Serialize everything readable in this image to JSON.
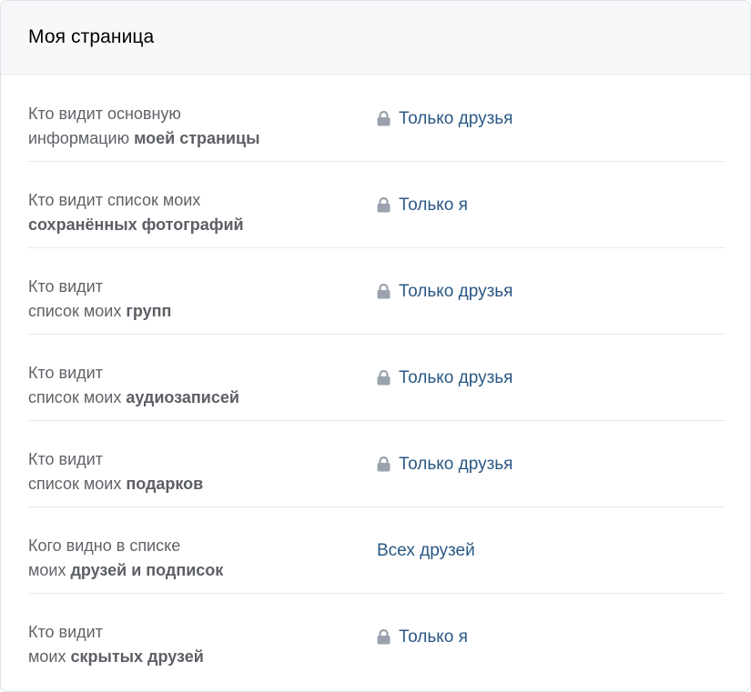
{
  "header": {
    "title": "Моя страница"
  },
  "rows": [
    {
      "label_a": "Кто видит основную",
      "label_b": "информацию ",
      "label_b_bold": "моей страницы",
      "value": "Только друзья",
      "icon": "lock-icon"
    },
    {
      "label_a": "Кто видит список моих",
      "label_b": "",
      "label_b_bold": "сохранённых фотографий",
      "value": "Только я",
      "icon": "lock-icon"
    },
    {
      "label_a": "Кто видит",
      "label_b": "список моих ",
      "label_b_bold": "групп",
      "value": "Только друзья",
      "icon": "lock-icon"
    },
    {
      "label_a": "Кто видит",
      "label_b": "список моих ",
      "label_b_bold": "аудиозаписей",
      "value": "Только друзья",
      "icon": "lock-icon"
    },
    {
      "label_a": "Кто видит",
      "label_b": "список моих ",
      "label_b_bold": "подарков",
      "value": "Только друзья",
      "icon": "lock-icon"
    },
    {
      "label_a": "Кого видно в списке",
      "label_b": "моих ",
      "label_b_bold": "друзей и подписок",
      "value": "Всех друзей",
      "icon": ""
    },
    {
      "label_a": "Кто видит",
      "label_b": "моих ",
      "label_b_bold": "скрытых друзей",
      "value": "Только я",
      "icon": "lock-icon"
    }
  ],
  "colors": {
    "link": "#2a5885",
    "label": "#5f6368",
    "lock": "#99a2ad",
    "divider": "#e7e8ec",
    "header_bg": "#f7f8fa"
  }
}
